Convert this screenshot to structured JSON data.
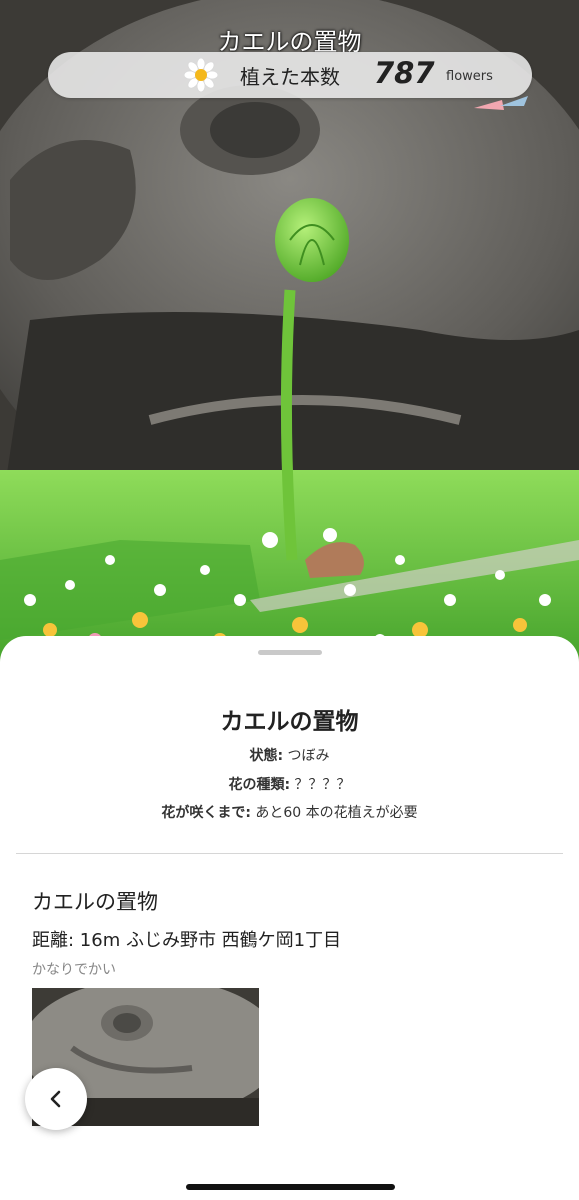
{
  "header": {
    "title": "カエルの置物",
    "count_label": "植えた本数",
    "count_value": "787",
    "count_unit": "flowers",
    "count_icon": "daisy-icon"
  },
  "sheet": {
    "title": "カエルの置物",
    "status_label": "状態:",
    "status_value": "つぼみ",
    "species_label": "花の種類:",
    "species_value": "？？？？",
    "bloom_label": "花が咲くまで:",
    "bloom_value": "あと60 本の花植えが必要"
  },
  "spot": {
    "name": "カエルの置物",
    "distance": "距離: 16m ふじみ野市 西鶴ケ岡1丁目",
    "note": "かなりでかい"
  },
  "nav": {
    "back_icon": "chevron-left-icon"
  },
  "colors": {
    "sprout_green": "#6fc43a",
    "grass_green": "#5fbf3a",
    "stone_gray": "#6f6d68"
  }
}
